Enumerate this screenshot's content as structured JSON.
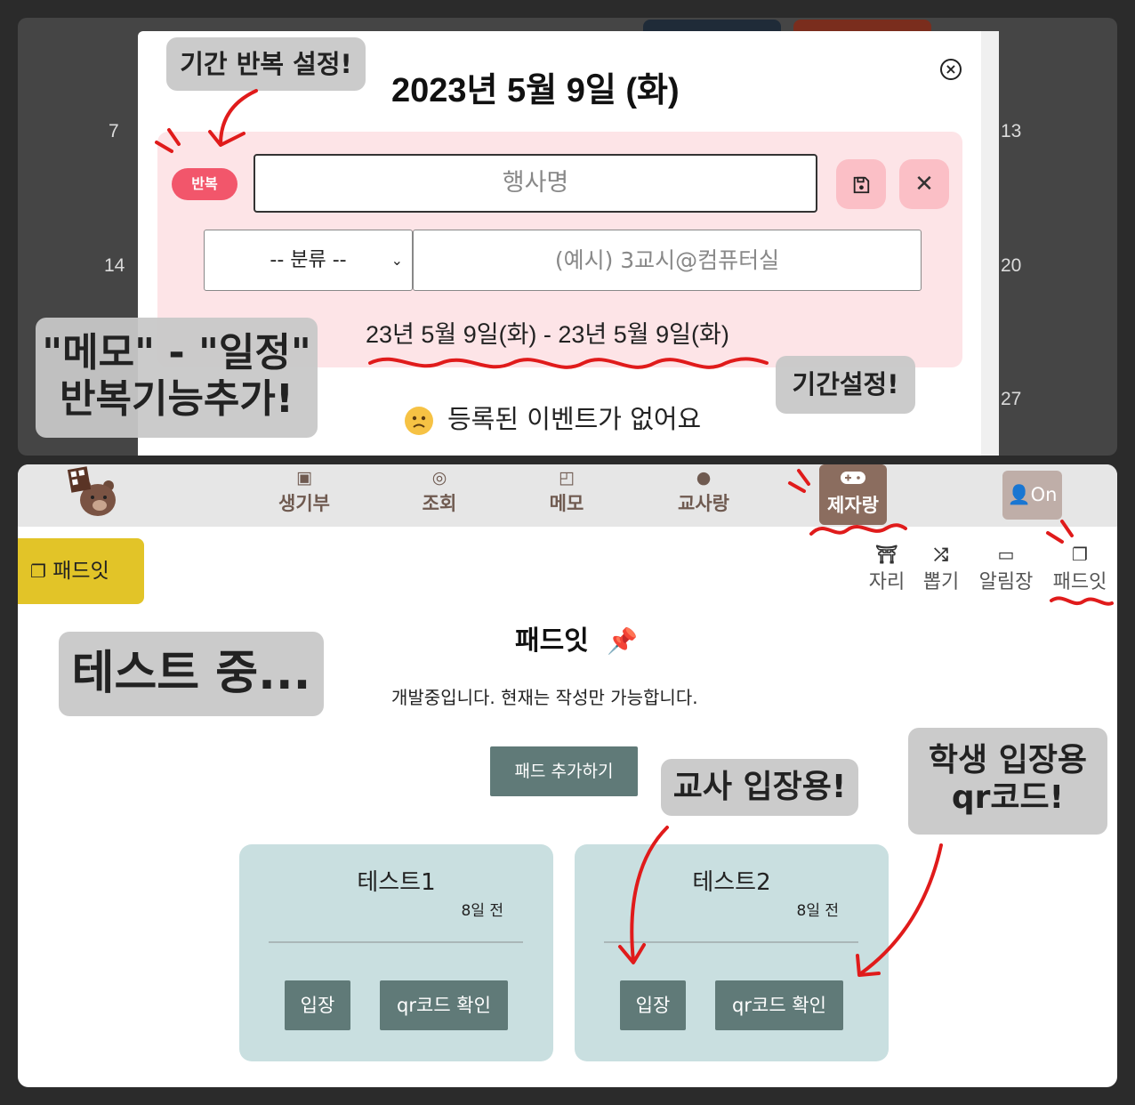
{
  "calendar": {
    "week_numbers_left": [
      "7",
      "14"
    ],
    "week_numbers_right": [
      "13",
      "20",
      "27"
    ]
  },
  "modal": {
    "title": "2023년 5월 9일 (화)",
    "close_icon": "close-circle-icon",
    "repeat_badge": "반복",
    "event_name_placeholder": "행사명",
    "save_icon": "floppy-disk-icon",
    "clear_label": "✕",
    "category_select_value": "-- 분류 --",
    "location_placeholder": "(예시) 3교시@컴퓨터실",
    "date_range": "23년 5월 9일(화) - 23년 5월 9일(화)",
    "no_event_message": "등록된 이벤트가 없어요"
  },
  "callouts": {
    "repeat_setting": "기간 반복 설정!",
    "memo_schedule_line1": "\"메모\" - \"일정\"",
    "memo_schedule_line2": "반복기능추가!",
    "period_setting": "기간설정!",
    "testing": "테스트 중...",
    "teacher_entry": "교사 입장용!",
    "student_qr_line1": "학생 입장용",
    "student_qr_line2": "qr코드!"
  },
  "navbar": {
    "items": [
      {
        "label": "생기부",
        "icon": "contact-book-icon"
      },
      {
        "label": "조회",
        "icon": "compass-icon"
      },
      {
        "label": "메모",
        "icon": "sticky-note-icon"
      },
      {
        "label": "교사랑",
        "icon": "cookie-icon"
      },
      {
        "label": "제자랑",
        "icon": "gamepad-icon",
        "active": true
      }
    ],
    "login_label": "On"
  },
  "subnav": {
    "section_tag": "패드잇",
    "items": [
      {
        "label": "자리",
        "icon": "chair-icon"
      },
      {
        "label": "뽑기",
        "icon": "shuffle-icon"
      },
      {
        "label": "알림장",
        "icon": "laptop-icon"
      },
      {
        "label": "패드잇",
        "icon": "copy-icon"
      }
    ]
  },
  "padlet": {
    "title": "패드잇",
    "title_icon": "pushpin-icon",
    "notice": "개발중입니다. 현재는 작성만 가능합니다.",
    "add_button": "패드 추가하기",
    "pads": [
      {
        "name": "테스트1",
        "time": "8일 전",
        "enter": "입장",
        "qr": "qr코드 확인"
      },
      {
        "name": "테스트2",
        "time": "8일 전",
        "enter": "입장",
        "qr": "qr코드 확인"
      }
    ]
  },
  "colors": {
    "accent_pink": "#f2566b",
    "form_background": "#fde4e7",
    "brown_active": "#8b6d5f",
    "pad_card": "#c9dfe0",
    "pad_button": "#607a78",
    "annotation_red": "#e01b1b",
    "tag_yellow": "#e2c428"
  }
}
